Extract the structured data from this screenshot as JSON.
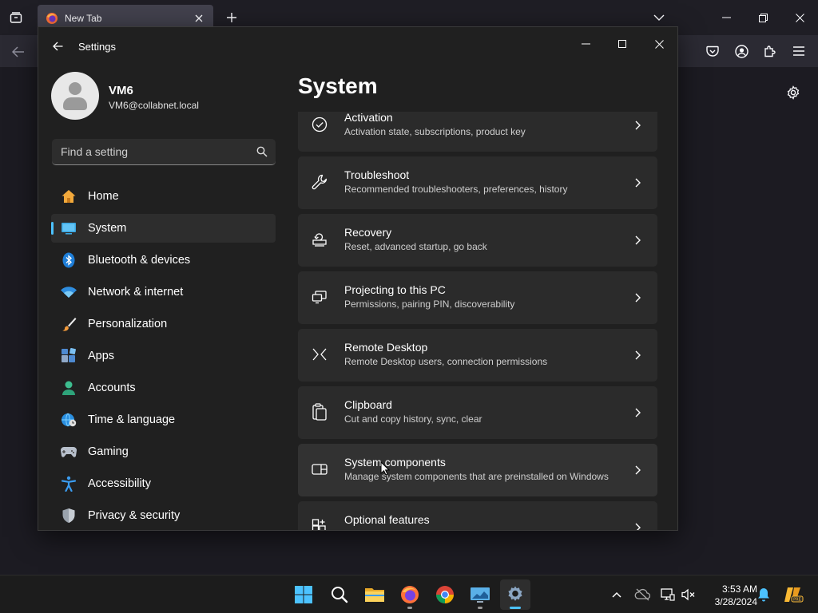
{
  "browser": {
    "tab_title": "New Tab"
  },
  "settings": {
    "window_title": "Settings",
    "user": {
      "name": "VM6",
      "email": "VM6@collabnet.local"
    },
    "search_placeholder": "Find a setting",
    "nav": [
      {
        "label": "Home",
        "icon": "home-icon"
      },
      {
        "label": "System",
        "icon": "system-icon",
        "selected": true
      },
      {
        "label": "Bluetooth & devices",
        "icon": "bluetooth-icon"
      },
      {
        "label": "Network & internet",
        "icon": "wifi-icon"
      },
      {
        "label": "Personalization",
        "icon": "brush-icon"
      },
      {
        "label": "Apps",
        "icon": "apps-icon"
      },
      {
        "label": "Accounts",
        "icon": "accounts-icon"
      },
      {
        "label": "Time & language",
        "icon": "globe-clock-icon"
      },
      {
        "label": "Gaming",
        "icon": "gamepad-icon"
      },
      {
        "label": "Accessibility",
        "icon": "accessibility-icon"
      },
      {
        "label": "Privacy & security",
        "icon": "shield-icon"
      }
    ],
    "page_title": "System",
    "cards": [
      {
        "title": "Activation",
        "subtitle": "Activation state, subscriptions, product key",
        "icon": "check-circle-icon"
      },
      {
        "title": "Troubleshoot",
        "subtitle": "Recommended troubleshooters, preferences, history",
        "icon": "wrench-icon"
      },
      {
        "title": "Recovery",
        "subtitle": "Reset, advanced startup, go back",
        "icon": "recovery-icon"
      },
      {
        "title": "Projecting to this PC",
        "subtitle": "Permissions, pairing PIN, discoverability",
        "icon": "projecting-icon"
      },
      {
        "title": "Remote Desktop",
        "subtitle": "Remote Desktop users, connection permissions",
        "icon": "remote-desktop-icon"
      },
      {
        "title": "Clipboard",
        "subtitle": "Cut and copy history, sync, clear",
        "icon": "clipboard-icon"
      },
      {
        "title": "System components",
        "subtitle": "Manage system components that are preinstalled on Windows",
        "icon": "system-components-icon",
        "hovered": true
      },
      {
        "title": "Optional features",
        "subtitle": "",
        "icon": "optional-features-icon"
      }
    ]
  },
  "taskbar": {
    "time": "3:53 AM",
    "date": "3/28/2024",
    "apps": [
      "start-icon",
      "search-icon",
      "file-explorer-icon",
      "firefox-icon",
      "chrome-icon",
      "remote-app-icon",
      "settings-icon"
    ],
    "accent": "#4cc2ff"
  }
}
